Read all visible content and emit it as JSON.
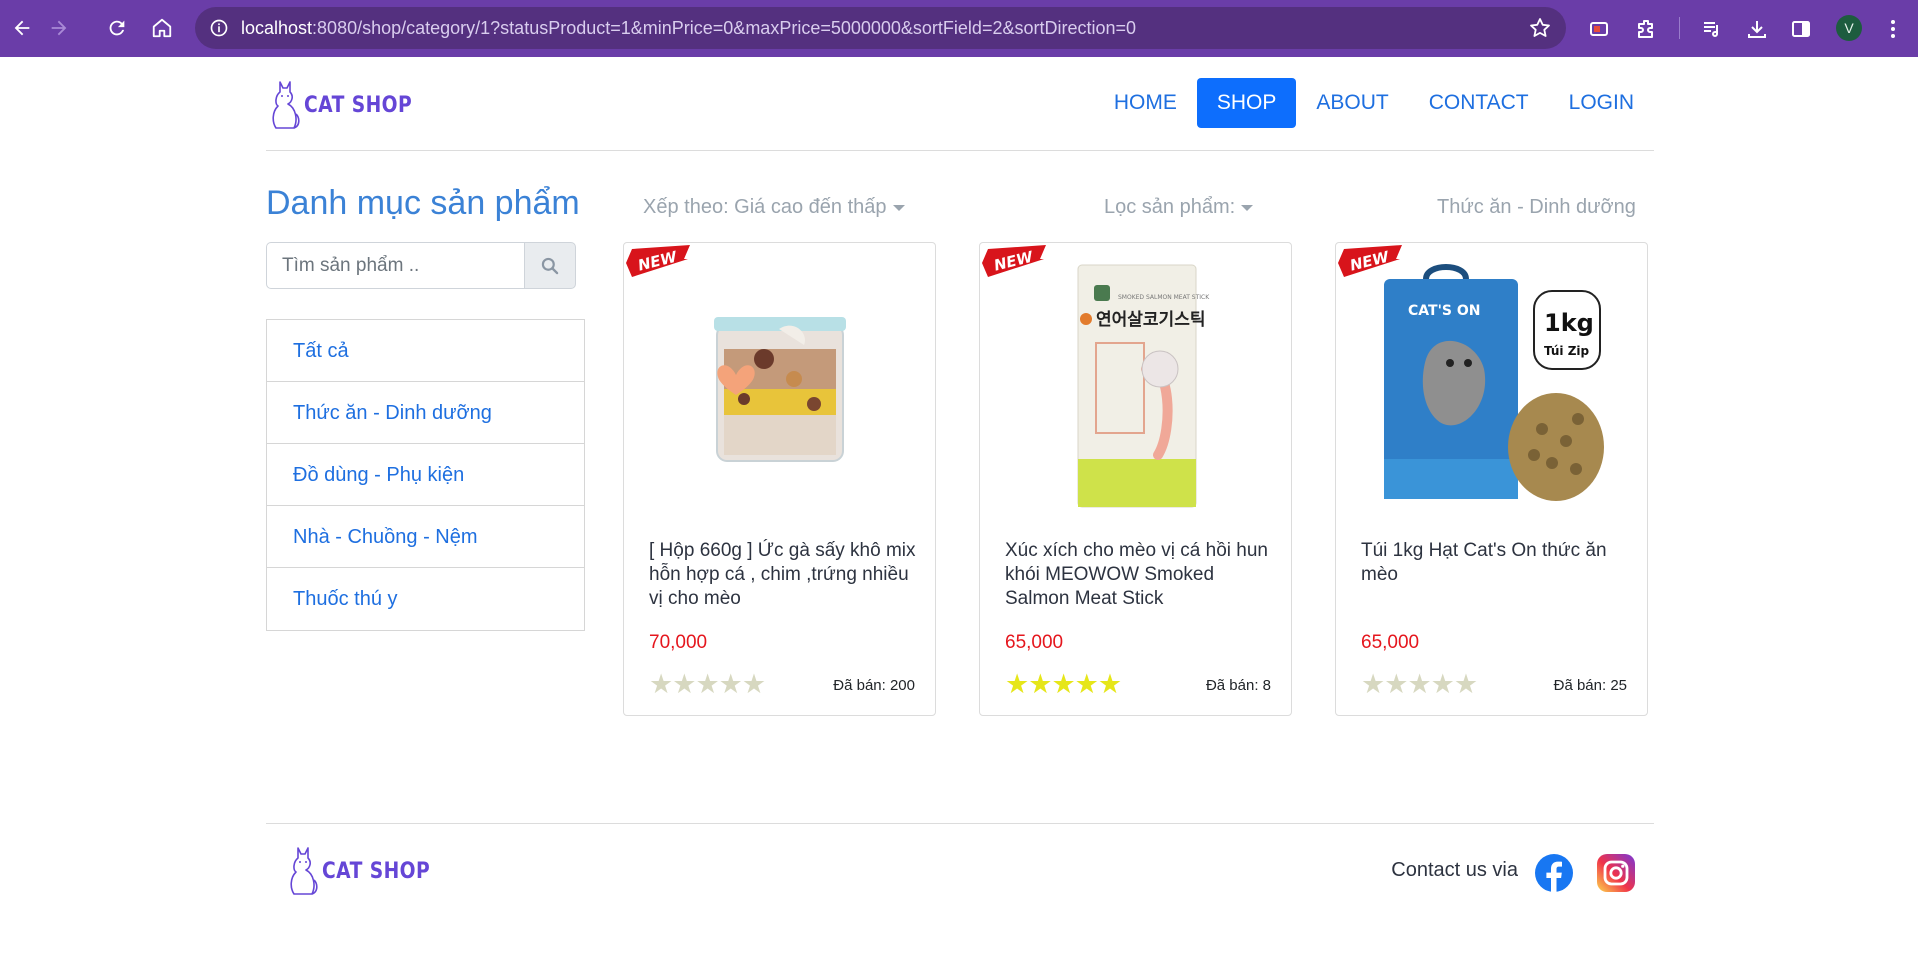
{
  "browser": {
    "url_host": "localhost",
    "url_rest": ":8080/shop/category/1?statusProduct=1&minPrice=0&maxPrice=5000000&sortField=2&sortDirection=0",
    "profile_initial": "V"
  },
  "header": {
    "brand": "CAT SHOP",
    "nav": [
      {
        "label": "HOME",
        "active": false
      },
      {
        "label": "SHOP",
        "active": true
      },
      {
        "label": "ABOUT",
        "active": false
      },
      {
        "label": "CONTACT",
        "active": false
      },
      {
        "label": "LOGIN",
        "active": false
      }
    ]
  },
  "sidebar": {
    "title": "Danh mục sản phẩm",
    "search_placeholder": "Tìm sản phẩm ..",
    "categories": [
      "Tất cả",
      "Thức ăn - Dinh dưỡng",
      "Đồ dùng - Phụ kiện",
      "Nhà - Chuồng - Nệm",
      "Thuốc thú y"
    ]
  },
  "toolbar": {
    "sort_label": "Xếp theo: Giá cao đến thấp",
    "filter_label": "Lọc sản phẩm:",
    "current_category": "Thức ăn - Dinh dưỡng"
  },
  "products": [
    {
      "badge": "NEW",
      "name": "[ Hộp 660g ] Ức gà sấy khô mix hỗn hợp cá , chim ,trứng nhiều vị cho mèo",
      "price": "70,000",
      "rating": 0,
      "sold": "Đã bán: 200"
    },
    {
      "badge": "NEW",
      "name": "Xúc xích cho mèo vị cá hồi hun khói MEOWOW Smoked Salmon Meat Stick",
      "price": "65,000",
      "rating": 5,
      "sold": "Đã bán: 8",
      "image_text": {
        "packet_label": "SMOKED SALMON MEAT STICK",
        "korean": "연어살코기스틱"
      }
    },
    {
      "badge": "NEW",
      "name": "Túi 1kg Hạt Cat's On thức ăn mèo",
      "price": "65,000",
      "rating": 0,
      "sold": "Đã bán: 25",
      "image_text": {
        "brand": "CAT'S ON",
        "weight": "1kg",
        "bag": "Túi Zip"
      }
    }
  ],
  "footer": {
    "brand": "CAT SHOP",
    "contact_label": "Contact us via"
  },
  "colors": {
    "browser_frame": "#6a3da8",
    "link": "#1e6fe0",
    "active_nav": "#0d6efd",
    "price": "#e5161d",
    "star_filled": "#e6e619",
    "star_empty": "#d7d8c0",
    "brand": "#6546d6"
  }
}
